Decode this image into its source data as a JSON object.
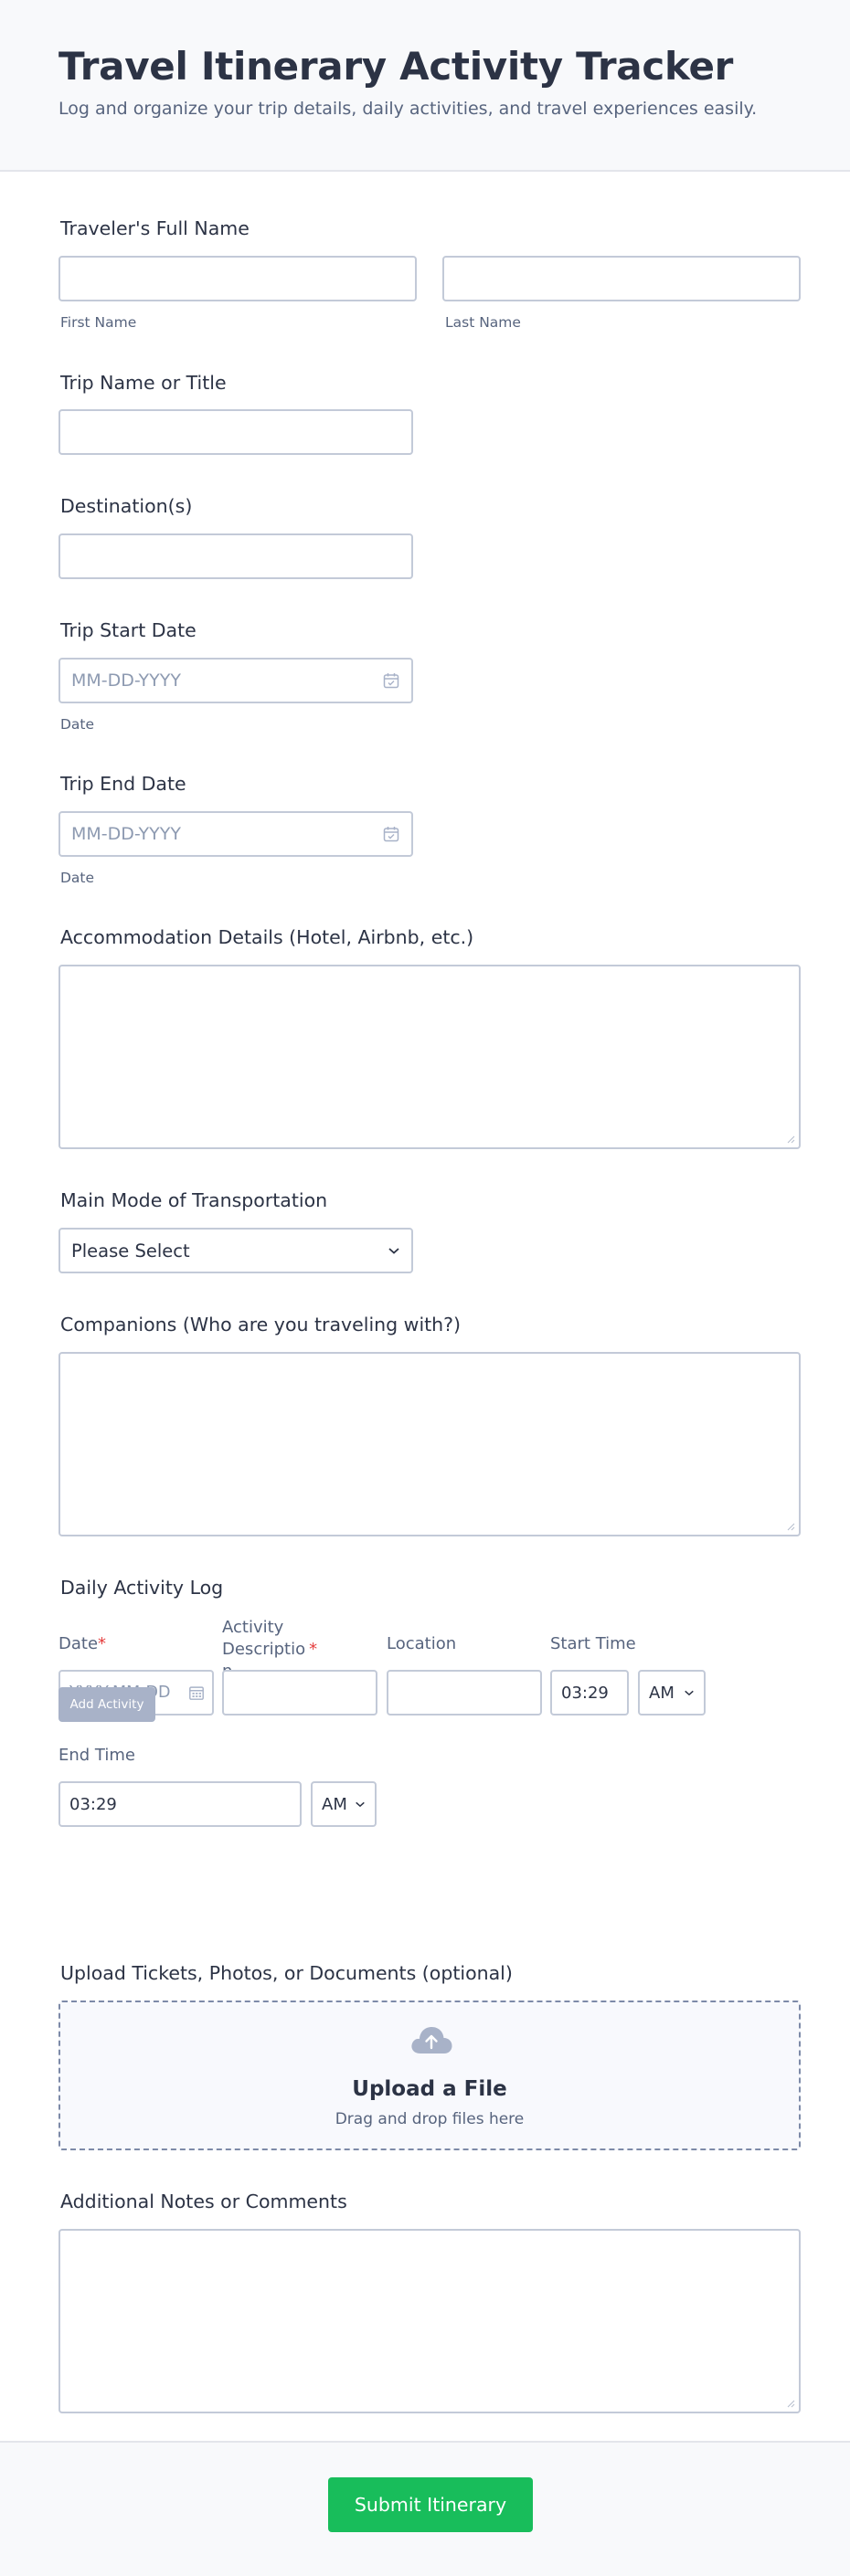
{
  "header": {
    "title": "Travel Itinerary Activity Tracker",
    "subtitle": "Log and organize your trip details, daily activities, and travel experiences easily."
  },
  "fields": {
    "full_name": {
      "label": "Traveler's Full Name",
      "first_sublabel": "First Name",
      "last_sublabel": "Last Name"
    },
    "trip_name": {
      "label": "Trip Name or Title"
    },
    "destinations": {
      "label": "Destination(s)"
    },
    "start_date": {
      "label": "Trip Start Date",
      "placeholder": "MM-DD-YYYY",
      "sublabel": "Date"
    },
    "end_date": {
      "label": "Trip End Date",
      "placeholder": "MM-DD-YYYY",
      "sublabel": "Date"
    },
    "accommodation": {
      "label": "Accommodation Details (Hotel, Airbnb, etc.)"
    },
    "transport": {
      "label": "Main Mode of Transportation",
      "selected": "Please Select"
    },
    "companions": {
      "label": "Companions (Who are you traveling with?)"
    }
  },
  "activity_log": {
    "label": "Daily Activity Log",
    "columns": {
      "date": "Date",
      "description_line1": "Activity Descriptio",
      "description_line2": "n",
      "location": "Location",
      "start_time": "Start Time"
    },
    "required_marker": "*",
    "date_placeholder": "YYYY-MM-DD",
    "start_time_value": "03:29",
    "start_ampm": "AM",
    "end_time_label": "End Time",
    "end_time_value": "03:29",
    "end_ampm": "AM",
    "add_button": "Add Activity"
  },
  "upload": {
    "label": "Upload Tickets, Photos, or Documents (optional)",
    "title": "Upload a File",
    "hint": "Drag and drop files here",
    "icon": "cloud-upload-icon"
  },
  "notes": {
    "label": "Additional Notes or Comments"
  },
  "footer": {
    "submit": "Submit Itinerary"
  },
  "colors": {
    "accent": "#18bd5b",
    "required": "#e53e3e",
    "add_button": "#a8b2c8",
    "text": "#2c3345",
    "muted": "#57647e"
  }
}
